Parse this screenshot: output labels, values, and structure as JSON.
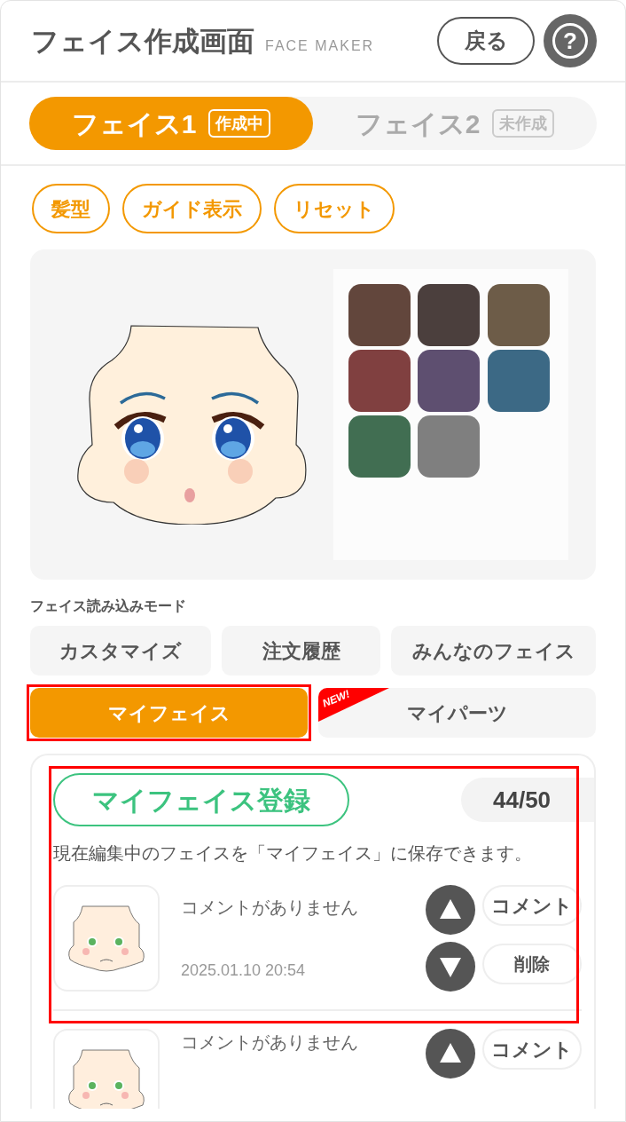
{
  "header": {
    "title": "フェイス作成画面",
    "subtitle": "FACE MAKER",
    "back_button": "戻る",
    "help_button": "?"
  },
  "face_tabs": [
    {
      "label": "フェイス1",
      "badge": "作成中",
      "selected": true
    },
    {
      "label": "フェイス2",
      "badge": "未作成",
      "selected": false
    }
  ],
  "tool_buttons": [
    "髪型",
    "ガイド表示",
    "リセット"
  ],
  "palette": [
    {
      "color": "#62463c"
    },
    {
      "color": "#4b3f3d"
    },
    {
      "color": "#6d5c48"
    },
    {
      "color": "#804040"
    },
    {
      "color": "#5e4f70"
    },
    {
      "color": "#3c6985"
    },
    {
      "color": "#416e52"
    },
    {
      "color": "#7f7f7f"
    }
  ],
  "load_mode": {
    "label": "フェイス読み込みモード",
    "modes": [
      {
        "label": "カスタマイズ",
        "selected": false,
        "highlighted": false
      },
      {
        "label": "注文履歴",
        "selected": false,
        "highlighted": false
      },
      {
        "label": "みんなのフェイス",
        "selected": false,
        "highlighted": false
      },
      {
        "label": "マイフェイス",
        "selected": true,
        "highlighted": true
      },
      {
        "label": "マイパーツ",
        "selected": false,
        "highlighted": false,
        "badge": "NEW!"
      }
    ]
  },
  "my_faces": {
    "register_button": "マイフェイス登録",
    "count": "44/50",
    "description": "現在編集中のフェイスを「マイフェイス」に保存できます。",
    "highlighted": true,
    "items": [
      {
        "comment": "コメントがありません",
        "date": "2025.01.10 20:54",
        "comment_button": "コメント",
        "delete_button": "削除"
      },
      {
        "comment": "コメントがありません",
        "comment_button": "コメント"
      }
    ]
  }
}
